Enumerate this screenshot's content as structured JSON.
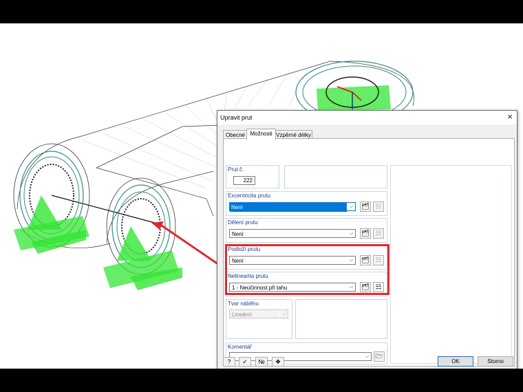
{
  "dialog": {
    "title": "Upravit prut",
    "close_glyph": "×",
    "tabs": [
      {
        "label": "Obecné",
        "active": false
      },
      {
        "label": "Možnosti",
        "active": true
      },
      {
        "label": "Vzpěrné délky",
        "active": false
      }
    ],
    "member_no": {
      "label": "Prut č.",
      "value": "222"
    },
    "eccentricity": {
      "label": "Excentricita prutu",
      "value": "Není"
    },
    "division": {
      "label": "Dělení prutu",
      "value": "Není"
    },
    "foundation": {
      "label": "Podloží prutu",
      "value": "Není"
    },
    "nonlinearity": {
      "label": "Nelinearita prutu",
      "value": "1 - Neúčinnost při tahu"
    },
    "taper": {
      "label": "Tvar náběhu",
      "value": "Lineární"
    },
    "comment": {
      "label": "Komentář",
      "value": ""
    },
    "ok_label": "OK",
    "cancel_label": "Storno"
  },
  "colors": {
    "highlight": "#e0282e",
    "group_label": "#1a3f99",
    "selection": "#0078d7",
    "support": "#33e633"
  }
}
